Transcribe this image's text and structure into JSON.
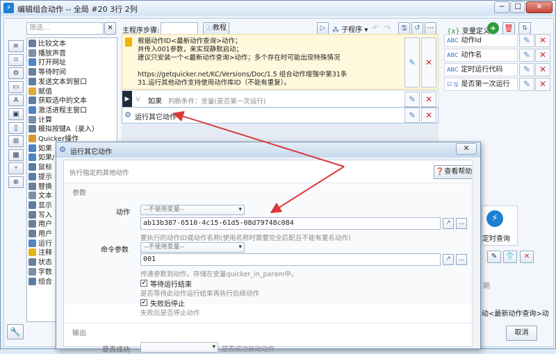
{
  "window": {
    "title": "编辑组合动作 -- 全局 #20 3行 2列",
    "minimize": "─",
    "maximize": "☐",
    "close": "✕"
  },
  "left": {
    "filter_placeholder": "筛选...",
    "clear": "✕",
    "toolbar_icons": [
      "list-icon",
      "bookmark-icon",
      "gear-icon",
      "window-icon",
      "text-icon",
      "image-icon",
      "file-icon",
      "windows-icon",
      "calculator-icon",
      "branch-icon",
      "globe-icon"
    ],
    "items": [
      "比较文本",
      "播放声音",
      "打开网址",
      "等待时间",
      "发送文本到窗口",
      "赋值",
      "获取选中的文本",
      "激活进程主窗口",
      "计算",
      "模拟按键A（录入）",
      "Quicker操作",
      "如果",
      "如果/",
      "鼠标",
      "提示",
      "替换",
      "文本",
      "显示",
      "写入",
      "用户",
      "用户",
      "运行",
      "注释",
      "状态",
      "字数",
      "组合"
    ],
    "item_colors": [
      "#6a7f9a",
      "#7b8fa8",
      "#4f84c4",
      "#6a7f9a",
      "#5d7ea3",
      "#e0a93a",
      "#5d7ea3",
      "#4f84c4",
      "#7b8fa8",
      "#6a7f9a",
      "#d49a2a",
      "#4f84c4",
      "#4f84c4",
      "#5d7ea3",
      "#5d7ea3",
      "#6a7f9a",
      "#7b8fa8",
      "#5d7ea3",
      "#6a7f9a",
      "#6a7f9a",
      "#6a7f9a",
      "#4f84c4",
      "#e7b21c",
      "#6a7f9a",
      "#7b8fa8",
      "#5d7ea3"
    ]
  },
  "header": {
    "steps_label": "主程序步骤:",
    "tutorial_label": "教程",
    "subprogram_label": "子程序",
    "vars_label": "变量定义",
    "vars_icon": "{x}"
  },
  "steps": {
    "note_lines": [
      "根据动作ID<最新动作查询>动作；",
      "并传入001参数，来实现静默启动；",
      "建议只安装一个<最新动作查询>动作；多个存在时可能出现特殊情况",
      "",
      "https://getquicker.net/KC/Versions/Doc/1.5 组合动作增强中第31条",
      "31.运行其他动作支持使用动作库ID（不能有重复）。"
    ],
    "if_label": "如果",
    "if_condition": "判断条件：变量(是否第一次运行)",
    "run_label": "运行其它动作"
  },
  "variables": [
    {
      "type": "ABC",
      "name": "动作Id"
    },
    {
      "type": "ABC",
      "name": "动作名"
    },
    {
      "type": "ABC",
      "name": "定时运行代码"
    },
    {
      "type": "☑ 🖫",
      "name": "是否第一次运行"
    }
  ],
  "right_panel": {
    "tile_label": "定时查询",
    "row_text": "动<最新动作查询>动",
    "field_label": "期",
    "cancel_label": "取消"
  },
  "dialog": {
    "title": "运行其它动作",
    "subtitle": "执行指定的其他动作",
    "help_label": "查看帮助",
    "params_label": "参数",
    "action_label": "动作",
    "action_combo": "--不使用变量--",
    "action_value": "ab13b387-6510-4c15-61d5-08d79748c084",
    "action_hint": "要执行的动作ID或动作名称(使用名称时需要完全匹配且不能有重名动作)",
    "cmd_label": "命令参数",
    "cmd_combo": "--不使用变量--",
    "cmd_value": "001",
    "cmd_hint": "传递参数到动作。存储在变量quicker_in_param中。",
    "wait_label": "等待运行结束",
    "wait_hint": "是否等待此动作运行结束再执行后续动作",
    "stop_label": "失败后停止",
    "stop_hint": "失败后是否停止动作",
    "output_label": "输出",
    "success_label": "是否成功",
    "success_hint": "是否成功启动动作"
  },
  "annotation_color": "#d93a3a"
}
